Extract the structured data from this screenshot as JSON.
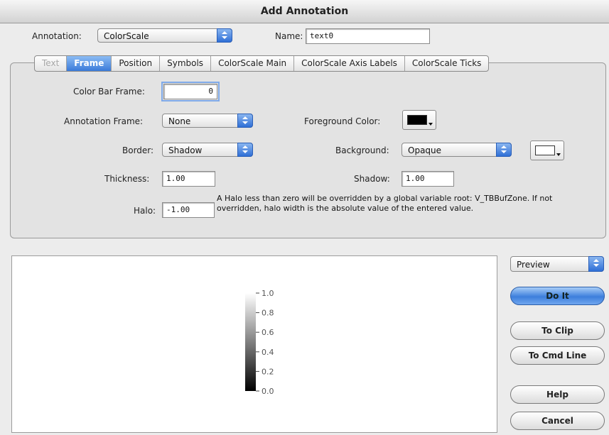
{
  "window": {
    "title": "Add Annotation"
  },
  "top": {
    "annotation_label": "Annotation:",
    "annotation_value": "ColorScale",
    "name_label": "Name:",
    "name_value": "text0"
  },
  "tabs": [
    {
      "label": "Text",
      "state": "disabled"
    },
    {
      "label": "Frame",
      "state": "active"
    },
    {
      "label": "Position",
      "state": "normal"
    },
    {
      "label": "Symbols",
      "state": "normal"
    },
    {
      "label": "ColorScale Main",
      "state": "normal"
    },
    {
      "label": "ColorScale Axis Labels",
      "state": "normal"
    },
    {
      "label": "ColorScale Ticks",
      "state": "normal"
    }
  ],
  "frame": {
    "color_bar_frame_label": "Color Bar Frame:",
    "color_bar_frame_value": "0",
    "annotation_frame_label": "Annotation Frame:",
    "annotation_frame_value": "None",
    "foreground_color_label": "Foreground Color:",
    "foreground_color": "#000000",
    "border_label": "Border:",
    "border_value": "Shadow",
    "background_label": "Background:",
    "background_value": "Opaque",
    "background_color": "#ffffff",
    "thickness_label": "Thickness:",
    "thickness_value": "1.00",
    "shadow_label": "Shadow:",
    "shadow_value": "1.00",
    "halo_label": "Halo:",
    "halo_value": "-1.00",
    "halo_note": "A Halo less than zero will be overridden by a global variable root: V_TBBufZone. If not overridden, halo width is the absolute value of the entered value."
  },
  "preview": {
    "mode": "Preview",
    "ticks": [
      "1.0",
      "0.8",
      "0.6",
      "0.4",
      "0.2",
      "0.0"
    ]
  },
  "buttons": {
    "do_it": "Do It",
    "to_clip": "To Clip",
    "to_cmd_line": "To Cmd Line",
    "help": "Help",
    "cancel": "Cancel"
  }
}
